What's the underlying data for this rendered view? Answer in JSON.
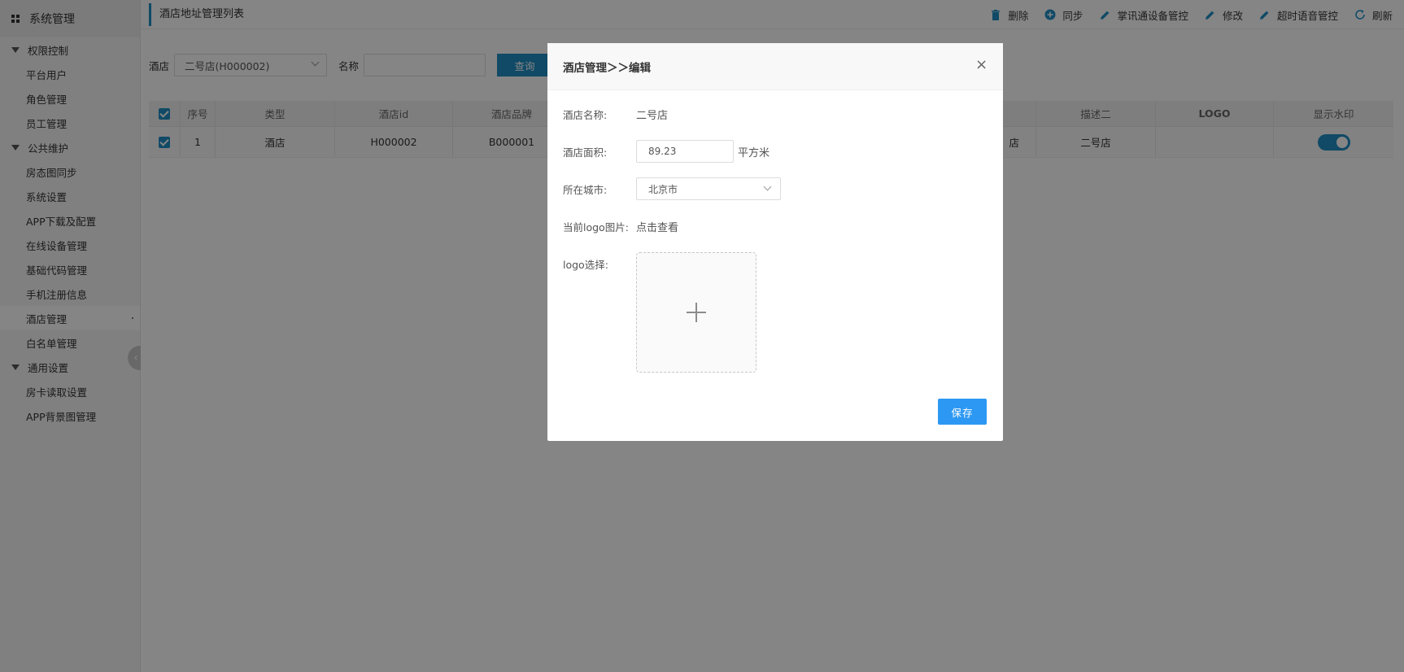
{
  "sidebar": {
    "title": "系统管理",
    "groups": [
      {
        "label": "权限控制",
        "items": [
          "平台用户",
          "角色管理",
          "员工管理"
        ]
      },
      {
        "label": "公共维护",
        "items": [
          "房态图同步",
          "系统设置",
          "APP下载及配置",
          "在线设备管理",
          "基础代码管理",
          "手机注册信息",
          "酒店管理",
          "白名单管理"
        ]
      },
      {
        "label": "通用设置",
        "items": [
          "房卡读取设置",
          "APP背景图管理"
        ]
      }
    ],
    "collapse_glyph": "‹"
  },
  "topbar": {
    "page_title": "酒店地址管理列表",
    "buttons": {
      "delete": "删除",
      "sync": "同步",
      "zhangxuntong": "掌讯通设备管控",
      "edit": "修改",
      "timeout_voice": "超时语音管控",
      "refresh": "刷新"
    }
  },
  "search": {
    "hotel_label": "酒店",
    "hotel_value": "二号店(H000002)",
    "name_label": "名称",
    "name_value": "",
    "query_label": "查询"
  },
  "table": {
    "headers": {
      "index": "序号",
      "type": "类型",
      "hotel_id": "酒店id",
      "brand": "酒店品牌",
      "desc_two": "描述二",
      "logo": "LOGO",
      "watermark": "显示水印"
    },
    "rows": [
      {
        "index": "1",
        "type": "酒店",
        "hotel_id": "H000002",
        "brand": "B000001",
        "desc_one_tail": "店",
        "desc_two": "二号店",
        "logo": "",
        "watermark_on": true
      }
    ]
  },
  "modal": {
    "title": "酒店管理＞＞编辑",
    "close_glyph": "×",
    "fields": {
      "name_label": "酒店名称:",
      "name_value": "二号店",
      "area_label": "酒店面积:",
      "area_value": "89.23",
      "area_unit": "平方米",
      "city_label": "所在城市:",
      "city_value": "北京市",
      "logo_current_label": "当前logo图片:",
      "logo_current_link": "点击查看",
      "logo_select_label": "logo选择:"
    },
    "save_label": "保存"
  },
  "colors": {
    "accent": "#1f8fc4",
    "save": "#2d98f3",
    "overlay": "rgba(0,0,0,0.48)"
  }
}
